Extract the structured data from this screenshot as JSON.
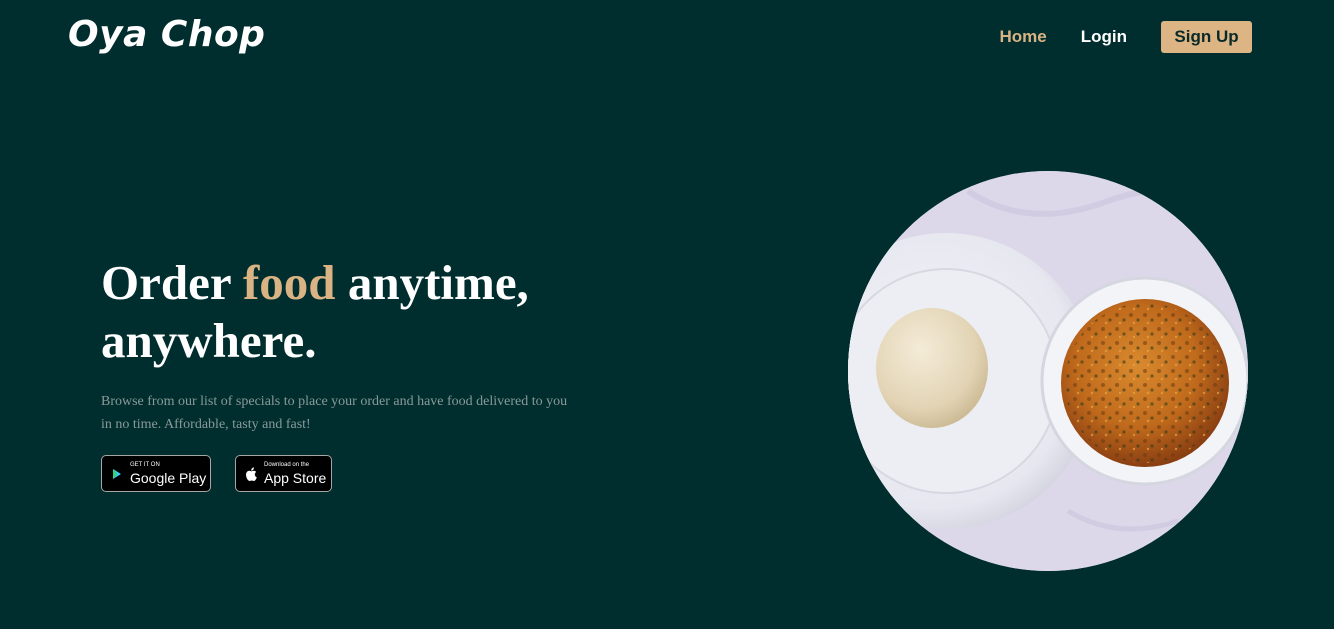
{
  "brand": {
    "logo_text": "Oya Chop"
  },
  "nav": {
    "home": "Home",
    "login": "Login",
    "signup": "Sign Up"
  },
  "hero": {
    "title_before": "Order ",
    "title_accent": "food",
    "title_after": " anytime, anywhere.",
    "description": "Browse from our list of specials to place your order and have food delivered to you in no time. Affordable, tasty and fast!"
  },
  "store_buttons": {
    "google": {
      "small": "GET IT ON",
      "big": "Google Play",
      "icon": "play-icon"
    },
    "apple": {
      "small": "Download on the",
      "big": "App Store",
      "icon": "apple-icon"
    }
  },
  "image": {
    "subject": "food-photo"
  },
  "colors": {
    "background": "#002e2e",
    "accent": "#d9b383",
    "signup_bg": "#ddb585"
  }
}
